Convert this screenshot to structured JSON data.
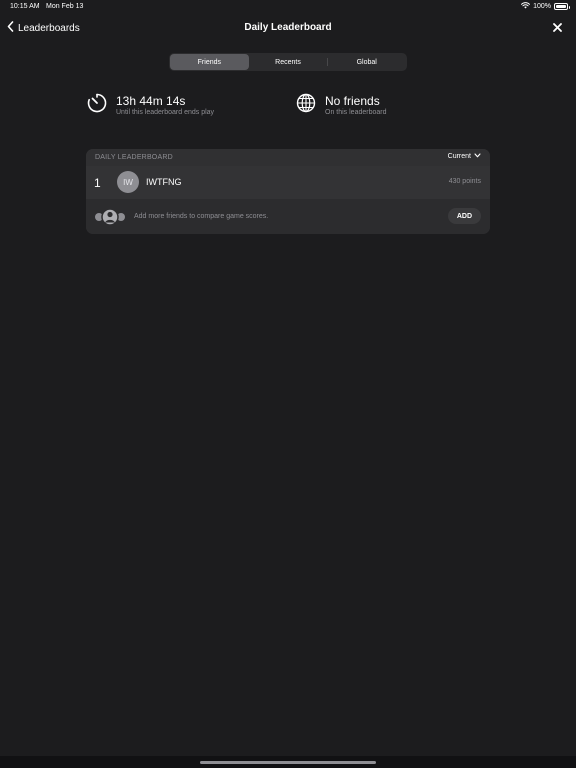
{
  "status_bar": {
    "time": "10:15 AM",
    "date": "Mon Feb 13",
    "battery": "100%",
    "battery_level": 1.0
  },
  "nav": {
    "back_label": "Leaderboards",
    "title": "Daily Leaderboard"
  },
  "tabs": [
    {
      "label": "Friends",
      "active": true
    },
    {
      "label": "Recents",
      "active": false
    },
    {
      "label": "Global",
      "active": false
    }
  ],
  "timer": {
    "value": "13h 44m 14s",
    "caption": "Until this leaderboard ends play",
    "icon": "timer-icon"
  },
  "friends_info": {
    "value": "No friends",
    "caption": "On this leaderboard",
    "icon": "globe-icon"
  },
  "leaderboard": {
    "header": "DAILY LEADERBOARD",
    "period": "Current",
    "entries": [
      {
        "rank": "1",
        "initials": "IW",
        "name": "IWTFNG",
        "points": "430 points"
      }
    ],
    "add_prompt": "Add more friends to compare game scores.",
    "add_label": "ADD"
  },
  "colors": {
    "background": "#1c1c1e",
    "card": "#2c2c2e",
    "secondary_text": "#8e8e93",
    "avatar": "#8e8e93"
  }
}
